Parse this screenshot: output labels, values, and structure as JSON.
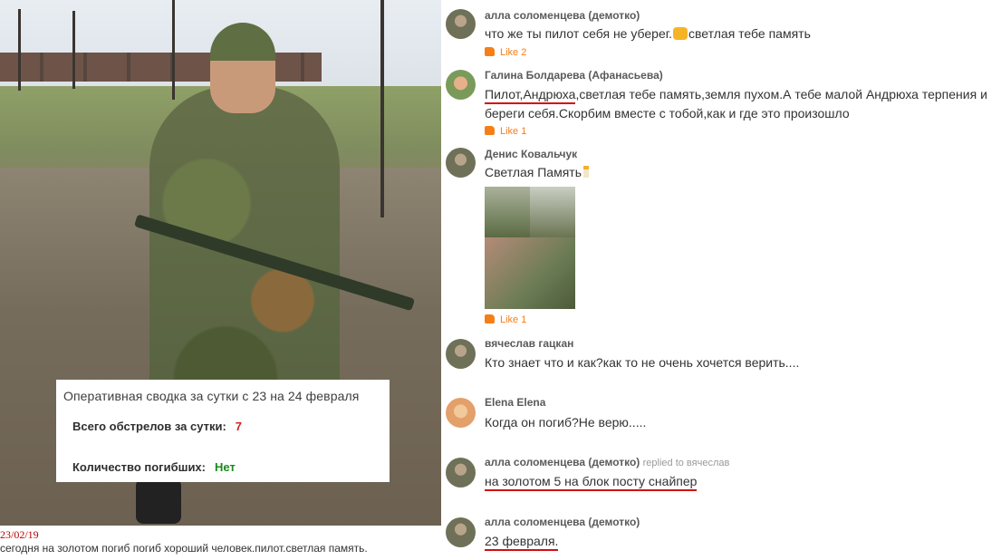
{
  "photo": {
    "report_title": "Оперативная сводка за сутки с 23 на 24 февраля",
    "shelling_label": "Всего обстрелов за сутки:",
    "shelling_value": "7",
    "deaths_label": "Количество погибших:",
    "deaths_value": "Нет"
  },
  "caption": {
    "date": "23/02/19",
    "text": "сегодня на золотом погиб погиб хороший человек.пилот.светлая память."
  },
  "comments": [
    {
      "author": "алла соломенцева (демотко)",
      "text_a": "что же ты пилот себя не уберег.",
      "text_b": "светлая тебе память",
      "likes": "Like 2"
    },
    {
      "author": "Галина Болдарева (Афанасьева)",
      "text_underlined": "Пилот,Андрюха",
      "text_rest": ",светлая тебе память,земля пухом.А тебе малой Андрюха терпения и",
      "text_line2": "береги себя.Скорбим вместе с тобой,как и где это произошло",
      "likes": "Like 1"
    },
    {
      "author": "Денис Ковальчук",
      "text": "Светлая Память",
      "likes": "Like 1"
    },
    {
      "author": "вячеслав гацкан",
      "text": "Кто знает что и как?как то не очень хочется верить...."
    },
    {
      "author": "Elena Elena",
      "text": "Когда он погиб?Не верю....."
    },
    {
      "author": "алла соломенцева (демотко)",
      "replied": "replied to вячеслав",
      "text": "на золотом 5 на блок посту снайпер"
    },
    {
      "author": "алла соломенцева (демотко)",
      "text": "23 февраля."
    }
  ],
  "colors": {
    "like": "#f57f17",
    "underline": "#d01010",
    "shelling_value": "#d62020",
    "deaths_value": "#1a8a1a",
    "caption_date": "#c00000"
  }
}
